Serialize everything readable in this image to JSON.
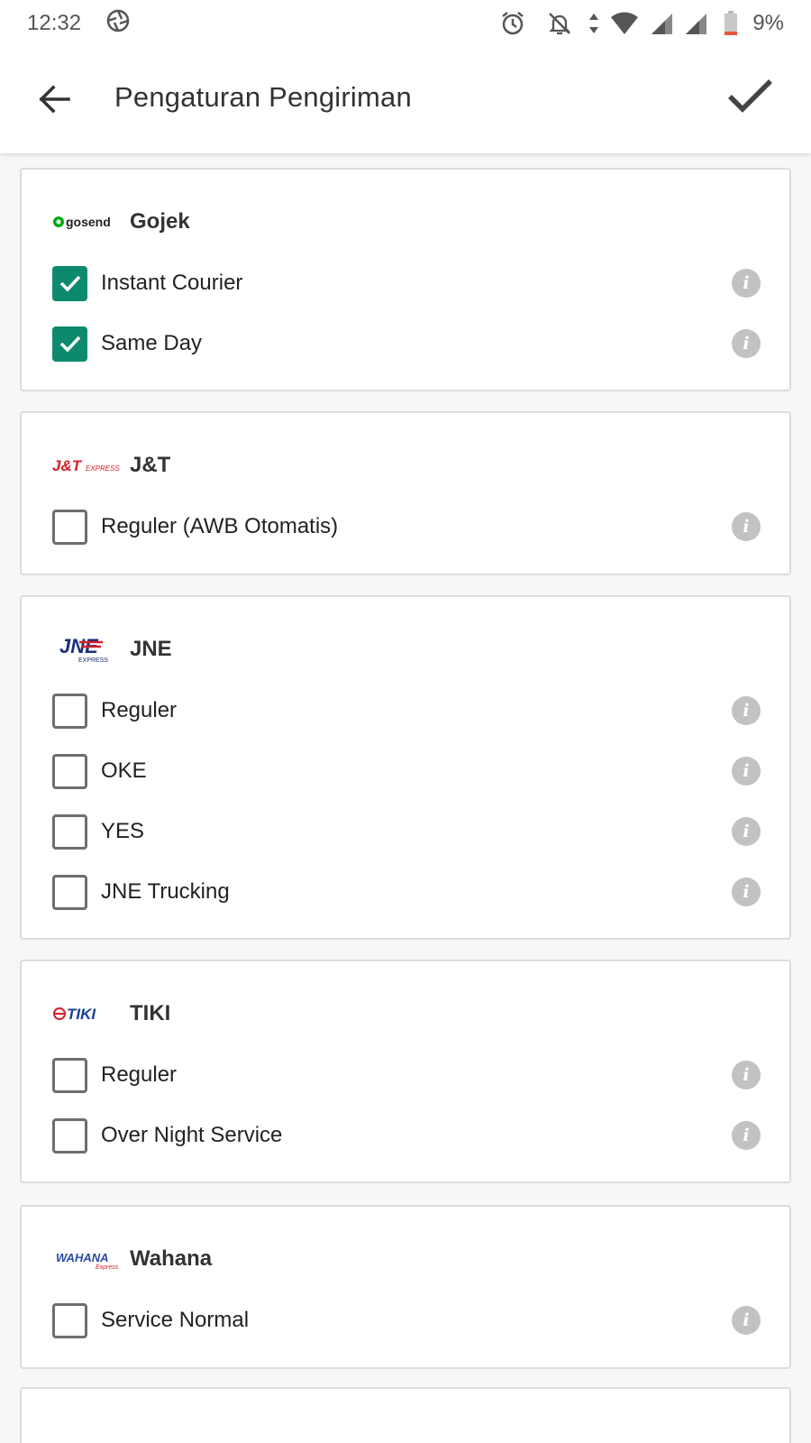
{
  "status_bar": {
    "time": "12:32",
    "battery": "9%",
    "icons": [
      "camera-aperture-icon",
      "alarm-icon",
      "notifications-off-icon",
      "data-arrows-icon",
      "wifi-icon",
      "signal-icon",
      "signal-icon",
      "battery-low-icon"
    ]
  },
  "app_bar": {
    "title": "Pengaturan Pengiriman",
    "back_icon": "arrow-back-icon",
    "confirm_icon": "checkmark-icon"
  },
  "colors": {
    "check_accent": "#0d8a6e",
    "info_icon": "#c2c2c2",
    "gosend_green": "#00aa13",
    "jnt_red": "#d6202a",
    "jne_navy": "#1b2f7c",
    "tiki_blue": "#1c3f94",
    "wahana_blue": "#2a4aa0"
  },
  "carriers": [
    {
      "name": "Gojek",
      "logo": "gosend",
      "options": [
        {
          "label": "Instant Courier",
          "checked": true
        },
        {
          "label": "Same Day",
          "checked": true
        }
      ]
    },
    {
      "name": "J&T",
      "logo": "J&T EXPRESS",
      "options": [
        {
          "label": "Reguler (AWB Otomatis)",
          "checked": false
        }
      ]
    },
    {
      "name": "JNE",
      "logo": "JNE EXPRESS",
      "options": [
        {
          "label": "Reguler",
          "checked": false
        },
        {
          "label": "OKE",
          "checked": false
        },
        {
          "label": "YES",
          "checked": false
        },
        {
          "label": "JNE Trucking",
          "checked": false
        }
      ]
    },
    {
      "name": "TIKI",
      "logo": "TIKI",
      "options": [
        {
          "label": "Reguler",
          "checked": false
        },
        {
          "label": "Over Night Service",
          "checked": false
        }
      ]
    },
    {
      "name": "Wahana",
      "logo": "WAHANA Express",
      "options": [
        {
          "label": "Service Normal",
          "checked": false
        }
      ]
    }
  ],
  "info_glyph": "i"
}
